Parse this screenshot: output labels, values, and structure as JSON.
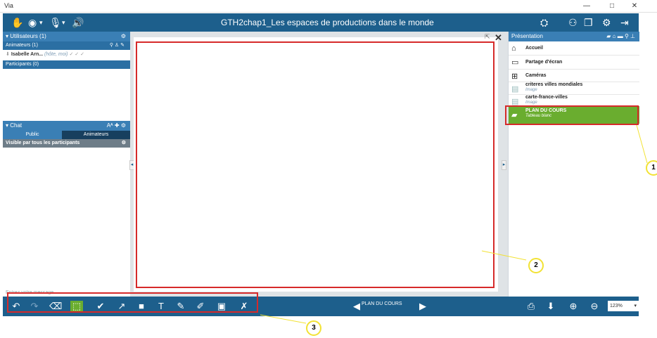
{
  "os": {
    "app_title": "Via",
    "btn_min": "—",
    "btn_max": "□",
    "btn_close": "✕"
  },
  "app_bar": {
    "session_title": "GTH2chap1_Les espaces de productions dans le monde",
    "left_icons": [
      "hand-raise-icon",
      "webcam-icon",
      "microphone-icon",
      "speaker-icon"
    ],
    "right_icons": [
      "share-icon",
      "users-network-icon",
      "layout-icon",
      "settings-icon",
      "exit-icon"
    ]
  },
  "users_panel": {
    "header": "Utilisateurs (1)",
    "animators_header": "Animateurs (1)",
    "user_name": "Isabelle Arn...",
    "user_role": "(hôte, moi)",
    "participants_header": "Participants (0)"
  },
  "chat": {
    "header": "Chat",
    "font_label": "Aᴬ",
    "tabs": [
      "Public",
      "Animateurs"
    ],
    "visibility": "Visible par tous les participants",
    "input_placeholder": "Entrez votre message..."
  },
  "presentation": {
    "header": "Présentation",
    "items": [
      {
        "label": "Accueil",
        "sub": "",
        "icon": "home-icon",
        "selected": false
      },
      {
        "label": "Partage d'écran",
        "sub": "",
        "icon": "monitor-icon",
        "selected": false
      },
      {
        "label": "Caméras",
        "sub": "",
        "icon": "camera-grid-icon",
        "selected": false
      },
      {
        "label": "criteres villes mondiales",
        "sub": "Image",
        "icon": "image-thumbnail-icon",
        "selected": false
      },
      {
        "label": "carte-france-villes",
        "sub": "Image",
        "icon": "image-thumbnail-icon",
        "selected": false
      },
      {
        "label": "PLAN DU COURS",
        "sub": "Tableau blanc",
        "icon": "whiteboard-icon",
        "selected": true
      }
    ]
  },
  "toolbar": {
    "doc_nav_label": "PLAN DU COURS",
    "zoom": "123%",
    "tools": [
      "undo-icon",
      "redo-icon",
      "eraser-icon",
      "select-icon",
      "check-icon",
      "arrow-icon",
      "rectangle-icon",
      "text-icon",
      "pen-icon",
      "highlighter-icon",
      "image-icon",
      "clear-icon"
    ]
  },
  "annotations": {
    "callout_1": "1",
    "callout_2": "2",
    "callout_3": "3"
  },
  "colors": {
    "brand_blue": "#1d5f8c",
    "selected_green": "#6aad2f",
    "annotation_red": "#d62a2a",
    "callout_yellow": "#f2e234"
  }
}
